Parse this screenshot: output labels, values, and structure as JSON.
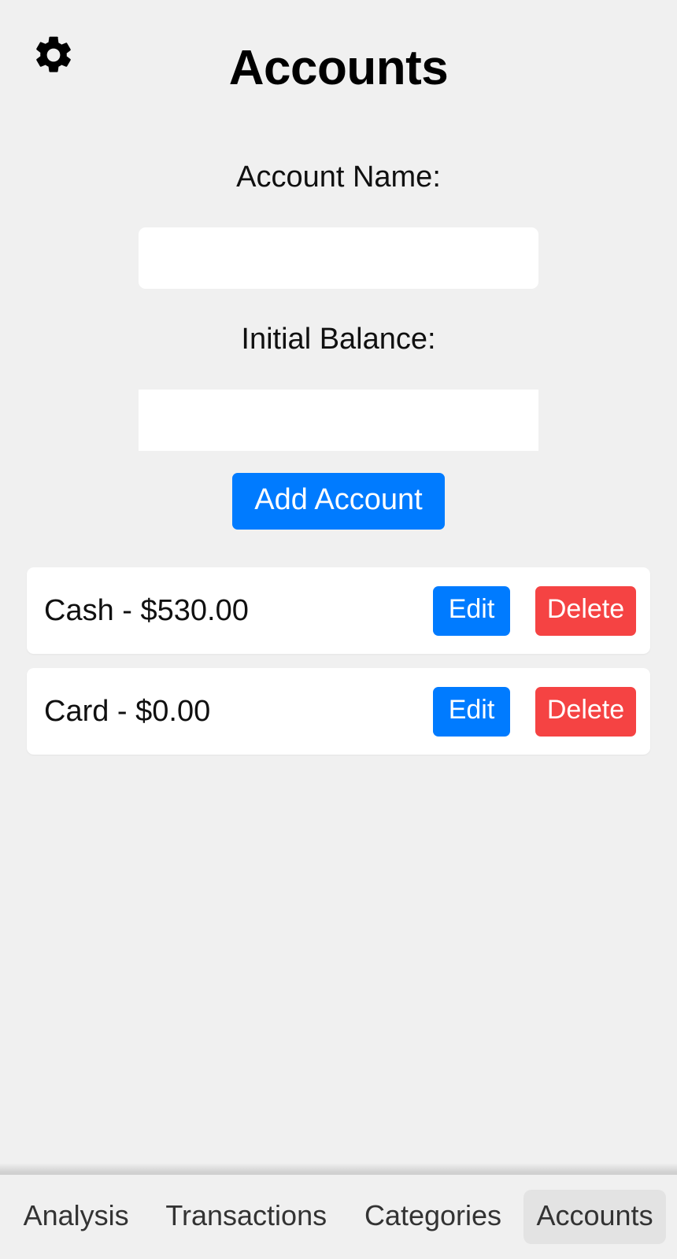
{
  "header": {
    "title": "Accounts",
    "settings_icon": "gear-icon"
  },
  "form": {
    "account_name_label": "Account Name:",
    "account_name_value": "",
    "account_name_placeholder": "",
    "initial_balance_label": "Initial Balance:",
    "initial_balance_value": "",
    "initial_balance_placeholder": "",
    "add_button_label": "Add Account"
  },
  "accounts": [
    {
      "label": "Cash - $530.00",
      "name": "Cash",
      "balance": "$530.00",
      "edit_label": "Edit",
      "delete_label": "Delete"
    },
    {
      "label": "Card - $0.00",
      "name": "Card",
      "balance": "$0.00",
      "edit_label": "Edit",
      "delete_label": "Delete"
    }
  ],
  "bottom_nav": {
    "items": [
      {
        "label": "Analysis",
        "active": false
      },
      {
        "label": "Transactions",
        "active": false
      },
      {
        "label": "Categories",
        "active": false
      },
      {
        "label": "Accounts",
        "active": true
      }
    ]
  },
  "colors": {
    "background": "#f0f0f0",
    "card": "#ffffff",
    "primary": "#007bff",
    "danger": "#f54343",
    "active_tab": "#e3e3e3",
    "text": "#101010",
    "nav_text": "#333333"
  }
}
